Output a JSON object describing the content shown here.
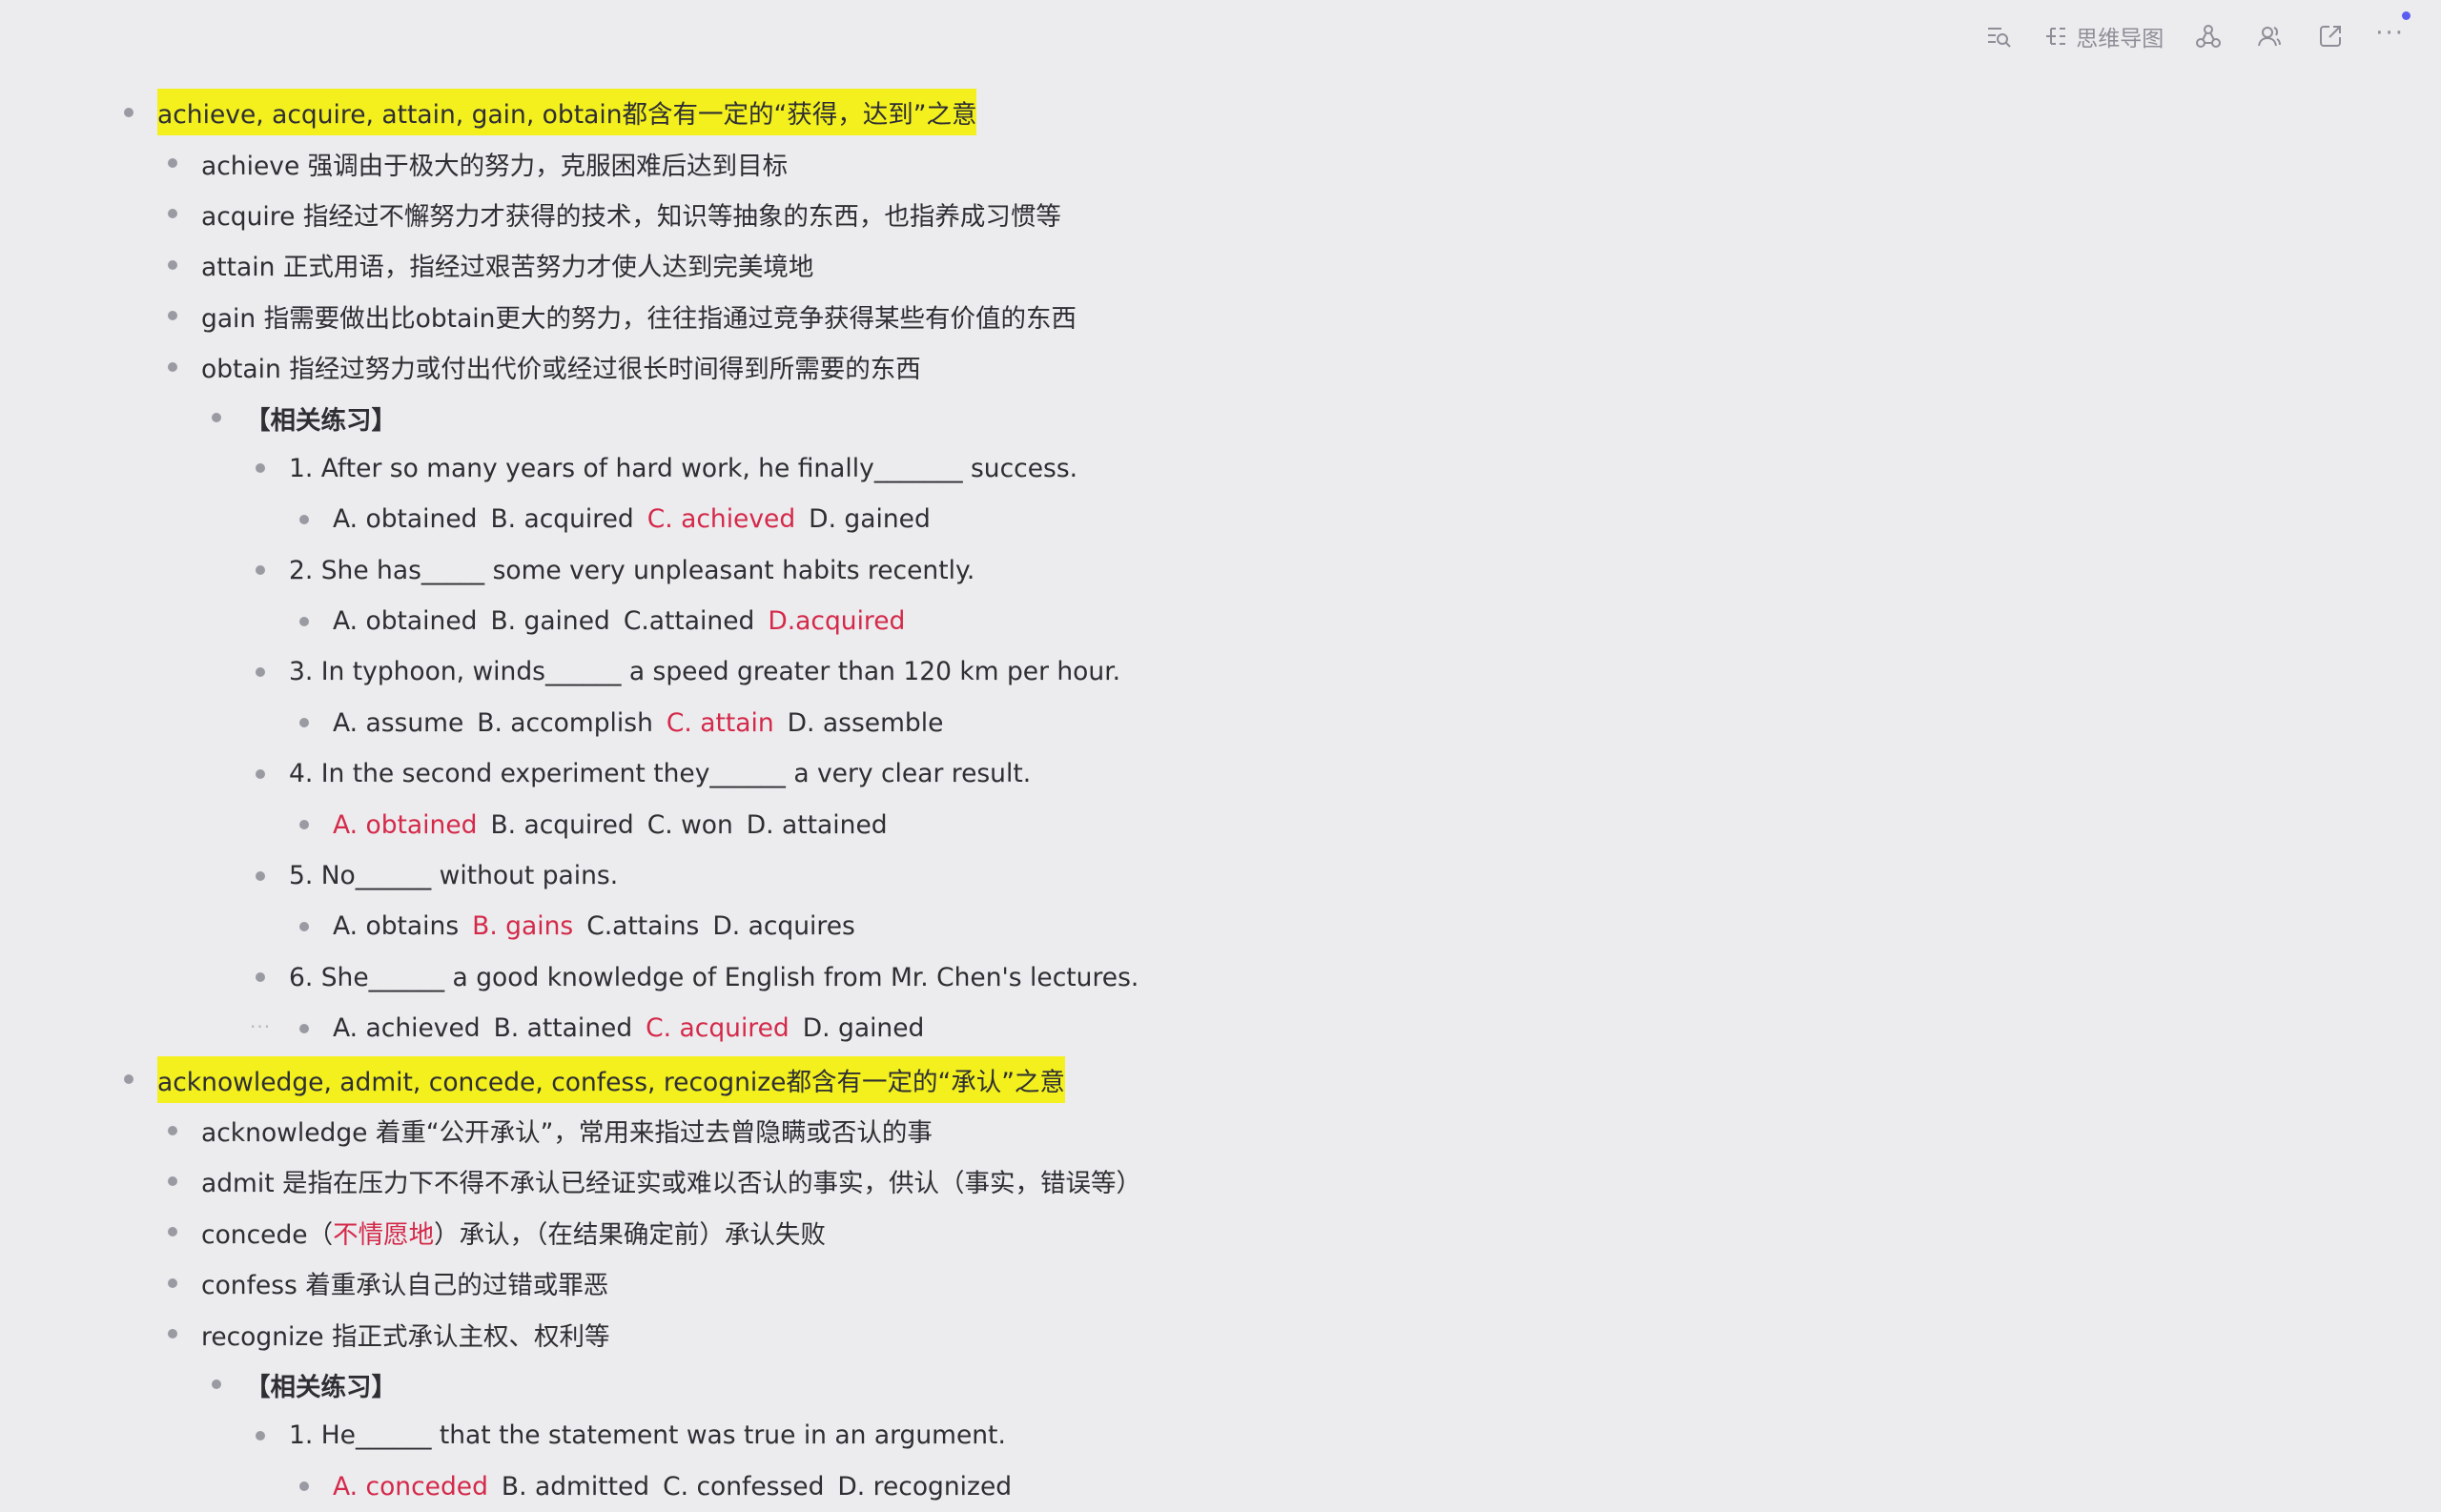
{
  "toolbar": {
    "mindmap_label": "思维导图",
    "more_label": "···"
  },
  "colors": {
    "highlight": "#f3f01e",
    "answer": "#d4294a",
    "accent": "#5b5cf0"
  },
  "outline": {
    "sec1": {
      "title": "achieve, acquire, attain, gain, obtain都含有一定的“获得，达到”之意",
      "items": [
        "achieve 强调由于极大的努力，克服困难后达到目标",
        "acquire 指经过不懈努力才获得的技术，知识等抽象的东西，也指养成习惯等",
        "attain 正式用语，指经过艰苦努力才使人达到完美境地",
        "gain 指需要做出比obtain更大的努力，往往指通过竞争获得某些有价值的东西",
        "obtain 指经过努力或付出代价或经过很长时间得到所需要的东西"
      ],
      "practice_label": "【相关练习】",
      "q": [
        {
          "text": "1. After so many years of hard work, he finally_______ success.",
          "options": [
            "A. obtained",
            "B. acquired",
            "C. achieved",
            "D. gained"
          ]
        },
        {
          "text": "2. She has_____ some very unpleasant habits recently.",
          "options": [
            "A. obtained",
            "B. gained",
            "C.attained",
            "D.acquired"
          ]
        },
        {
          "text": "3. In typhoon, winds______ a speed greater than 120 km per hour.",
          "options": [
            "A. assume",
            "B. accomplish",
            "C. attain",
            "D. assemble"
          ]
        },
        {
          "text": "4. In the second experiment they______ a very clear result.",
          "options": [
            "A. obtained",
            "B. acquired",
            "C. won",
            "D. attained"
          ]
        },
        {
          "text": "5. No______ without pains.",
          "options": [
            "A. obtains",
            "B. gains",
            "C.attains",
            "D.  acquires"
          ]
        },
        {
          "text": "6. She______ a good knowledge of English from Mr. Chen's lectures.",
          "options": [
            "A. achieved",
            "B. attained",
            "C. acquired",
            "D. gained"
          ]
        }
      ]
    },
    "sec2": {
      "title": "acknowledge, admit, concede, confess, recognize都含有一定的“承认”之意",
      "items": [
        "acknowledge 着重“公开承认”，常用来指过去曾隐瞒或否认的事",
        "admit 是指在压力下不得不承认已经证实或难以否认的事实，供认（事实，错误等）"
      ],
      "concede": {
        "pre": "concede（",
        "red": "不情愿地",
        "post": "）承认，（在结果确定前）承认失败"
      },
      "items2": [
        "confess 着重承认自己的过错或罪恶",
        "recognize 指正式承认主权、权利等"
      ],
      "practice_label": "【相关练习】",
      "q": [
        {
          "text": "1. He______ that the statement was true in an argument.",
          "options": [
            "A. conceded",
            "B. admitted",
            "C. confessed",
            "D. recognized"
          ]
        }
      ]
    }
  }
}
